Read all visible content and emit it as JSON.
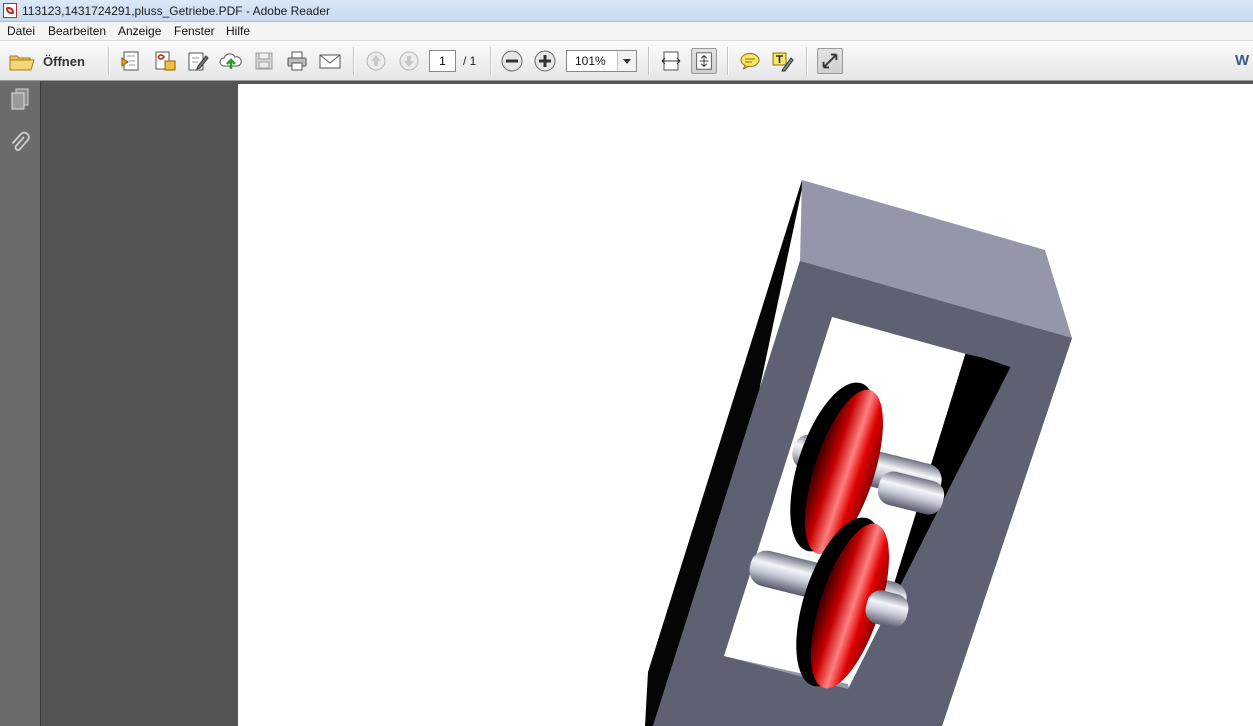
{
  "window": {
    "title": "113123,1431724291,pluss_Getriebe.PDF - Adobe Reader"
  },
  "menu": {
    "items": [
      "Datei",
      "Bearbeiten",
      "Anzeige",
      "Fenster",
      "Hilfe"
    ]
  },
  "toolbar": {
    "open_label": "Öffnen",
    "page_current": "1",
    "page_total": "/ 1",
    "zoom_value": "101%",
    "right_text": "W"
  },
  "icons": {
    "open": "folder-icon",
    "create": "create-pdf-icon",
    "export": "export-pdf-icon",
    "edit": "edit-pdf-icon",
    "upload": "cloud-upload-icon",
    "save": "save-icon",
    "print": "print-icon",
    "email": "email-icon",
    "prev": "page-up-icon",
    "next": "page-down-icon",
    "zoom_out": "zoom-out-icon",
    "zoom_in": "zoom-in-icon",
    "fit_width": "fit-width-icon",
    "fit_page": "fit-page-icon",
    "comment": "comment-icon",
    "highlight": "highlight-text-icon",
    "fullscreen": "fullscreen-icon",
    "pages_panel": "pages-icon",
    "attachments_panel": "paperclip-icon"
  },
  "colors": {
    "gear_red": "#d10000",
    "frame_face": "#5f6372",
    "frame_top": "#9498a8",
    "shaft": "#c8cbd6"
  }
}
